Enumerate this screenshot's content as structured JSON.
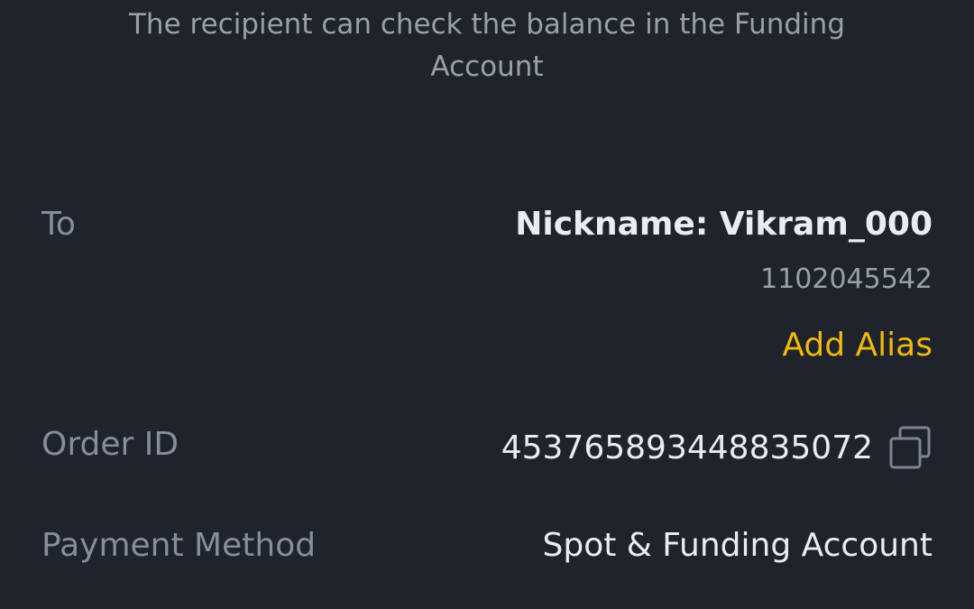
{
  "notice": {
    "text": "The recipient can check the balance in the Funding Account"
  },
  "recipient": {
    "label": "To",
    "nickname": "Nickname: Vikram_000",
    "uid": "1102045542",
    "add_alias_label": "Add Alias"
  },
  "order": {
    "label": "Order ID",
    "id": "453765893448835072",
    "copy_icon": "copy-icon"
  },
  "payment": {
    "label": "Payment Method",
    "value": "Spot & Funding Account"
  },
  "colors": {
    "background": "#1f232c",
    "accent": "#f0b90b",
    "primary_text": "#eaecef",
    "secondary_text": "#848e9c"
  }
}
